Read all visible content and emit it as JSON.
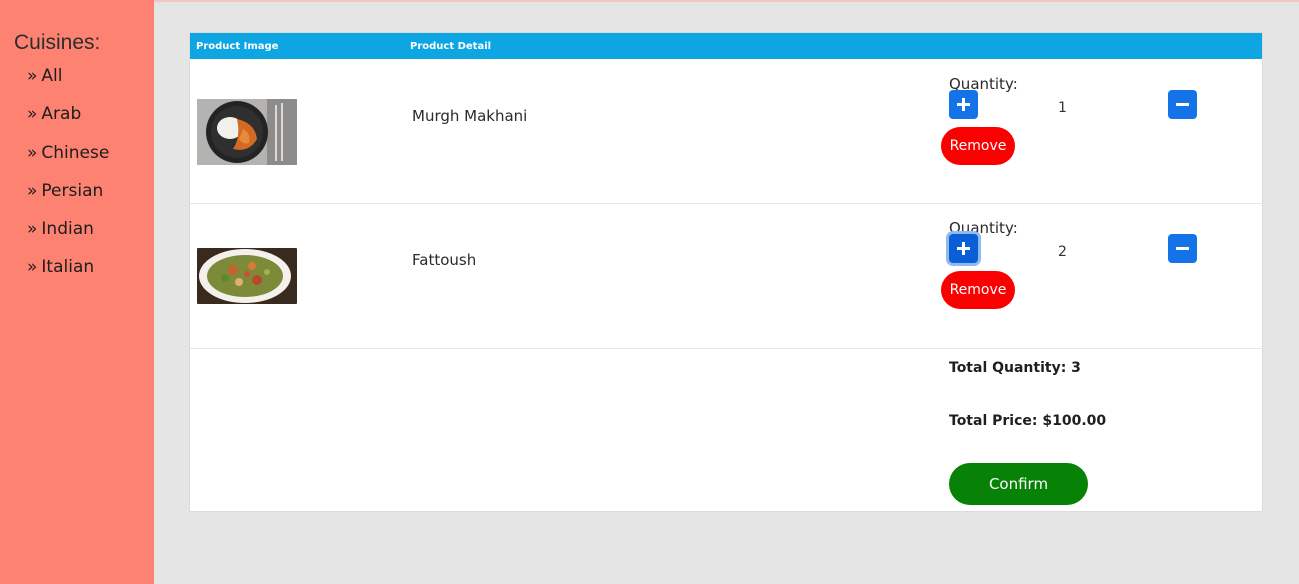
{
  "sidebar": {
    "title": "Cuisines:",
    "bullet": "»",
    "items": [
      {
        "label": "All"
      },
      {
        "label": "Arab"
      },
      {
        "label": "Chinese"
      },
      {
        "label": "Persian"
      },
      {
        "label": "Indian"
      },
      {
        "label": "Italian"
      }
    ]
  },
  "cart": {
    "headers": {
      "image": "Product Image",
      "detail": "Product Detail"
    },
    "quantity_label": "Quantity:",
    "remove_label": "Remove",
    "items": [
      {
        "name": "Murgh Makhani",
        "quantity": "1",
        "image_icon": "food-photo-icon"
      },
      {
        "name": "Fattoush",
        "quantity": "2",
        "image_icon": "food-photo-icon"
      }
    ],
    "total_quantity": "Total Quantity: 3",
    "total_price": "Total Price: $100.00",
    "confirm_label": "Confirm"
  },
  "colors": {
    "sidebar_bg": "#fe8271",
    "header_bg": "#0ea5e3",
    "qty_button": "#1573e8",
    "remove_button": "#fb0000",
    "confirm_button": "#078106"
  }
}
